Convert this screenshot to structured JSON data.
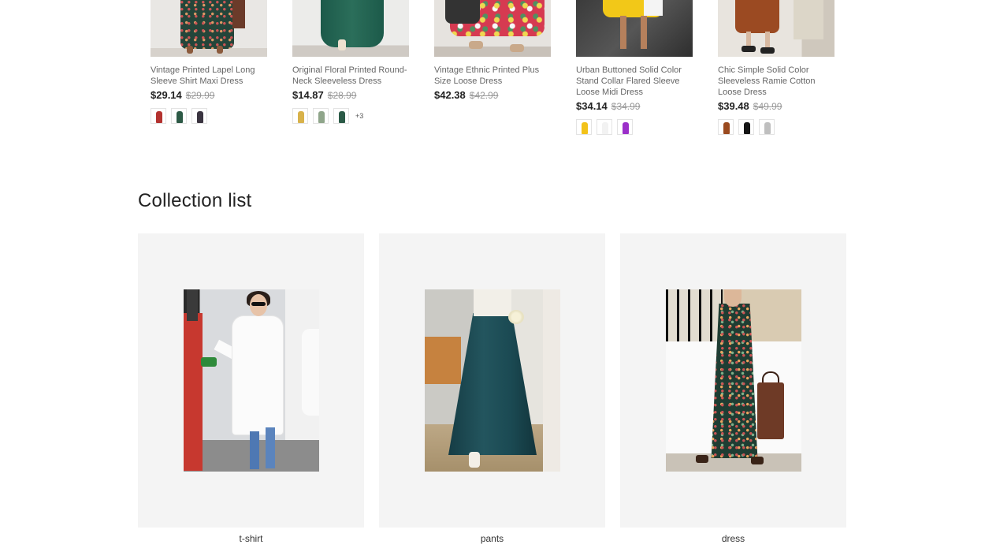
{
  "products": [
    {
      "title": "Vintage Printed Lapel Long Sleeve Shirt Maxi Dress",
      "price": "$29.14",
      "original_price": "$29.99",
      "swatches": [
        "#b3322f",
        "#2d5a46",
        "#3a3440"
      ],
      "more": ""
    },
    {
      "title": "Original Floral Printed Round-Neck Sleeveless Dress",
      "price": "$14.87",
      "original_price": "$28.99",
      "swatches": [
        "#d8b24a",
        "#8fa58a",
        "#2b5a47"
      ],
      "more": "+3"
    },
    {
      "title": "Vintage Ethnic Printed Plus Size Loose Dress",
      "price": "$42.38",
      "original_price": "$42.99",
      "swatches": [],
      "more": ""
    },
    {
      "title": "Urban Buttoned Solid Color Stand Collar Flared Sleeve Loose Midi Dress",
      "price": "$34.14",
      "original_price": "$34.99",
      "swatches": [
        "#f2c21a",
        "#f2f2f2",
        "#9b2fc9"
      ],
      "more": ""
    },
    {
      "title": "Chic Simple Solid Color Sleeveless Ramie Cotton Loose Dress",
      "price": "$39.48",
      "original_price": "$49.99",
      "swatches": [
        "#9a4a1f",
        "#151515",
        "#bfbfbf"
      ],
      "more": ""
    }
  ],
  "collection_section": {
    "title": "Collection list",
    "items": [
      {
        "label": "t-shirt"
      },
      {
        "label": "pants"
      },
      {
        "label": "dress"
      }
    ]
  }
}
